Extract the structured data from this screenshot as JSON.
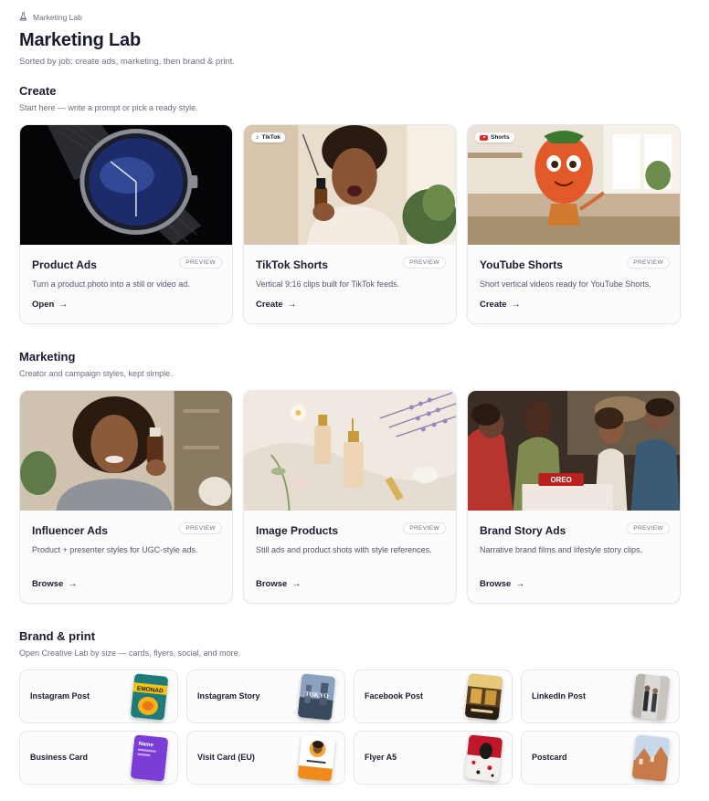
{
  "breadcrumb": {
    "label": "Marketing Lab",
    "icon": "flask-icon"
  },
  "page": {
    "title": "Marketing Lab",
    "subtitle": "Sorted by job: create ads, marketing, then brand & print."
  },
  "sections": {
    "create": {
      "title": "Create",
      "subtitle": "Start here — write a prompt or pick a ready style.",
      "cards": [
        {
          "title": "Product Ads",
          "badge": "PREVIEW",
          "description": "Turn a product photo into a still or video ad.",
          "action": "Open",
          "chip": ""
        },
        {
          "title": "TikTok Shorts",
          "badge": "PREVIEW",
          "description": "Vertical 9:16 clips built for TikTok feeds.",
          "action": "Create",
          "chip": "TikTok"
        },
        {
          "title": "YouTube Shorts",
          "badge": "PREVIEW",
          "description": "Short vertical videos ready for YouTube Shorts.",
          "action": "Create",
          "chip": "Shorts"
        }
      ]
    },
    "marketing": {
      "title": "Marketing",
      "subtitle": "Creator and campaign styles, kept simple.",
      "cards": [
        {
          "title": "Influencer Ads",
          "badge": "PREVIEW",
          "description": "Product + presenter styles for UGC-style ads.",
          "action": "Browse",
          "thumb_text": ""
        },
        {
          "title": "Image Products",
          "badge": "PREVIEW",
          "description": "Still ads and product shots with style references.",
          "action": "Browse",
          "thumb_text": ""
        },
        {
          "title": "Brand Story Ads",
          "badge": "PREVIEW",
          "description": "Narrative brand films and lifestyle story clips.",
          "action": "Browse",
          "thumb_text": "OREO"
        }
      ]
    },
    "brand": {
      "title": "Brand & print",
      "subtitle": "Open Creative Lab by size — cards, flyers, social, and more.",
      "tiles": [
        {
          "label": "Instagram Post",
          "thumb_text": "EMONAD"
        },
        {
          "label": "Instagram Story",
          "thumb_text": "TOKYO"
        },
        {
          "label": "Facebook Post",
          "thumb_text": ""
        },
        {
          "label": "LinkedIn Post",
          "thumb_text": ""
        },
        {
          "label": "Business Card",
          "thumb_text": "Name"
        },
        {
          "label": "Visit Card (EU)",
          "thumb_text": ""
        },
        {
          "label": "Flyer A5",
          "thumb_text": ""
        },
        {
          "label": "Postcard",
          "thumb_text": ""
        }
      ]
    }
  },
  "colors": {
    "text": "#1a1b2e",
    "muted": "#6b6e7d",
    "border": "#e6e7ec",
    "youtube": "#e02a2a"
  }
}
